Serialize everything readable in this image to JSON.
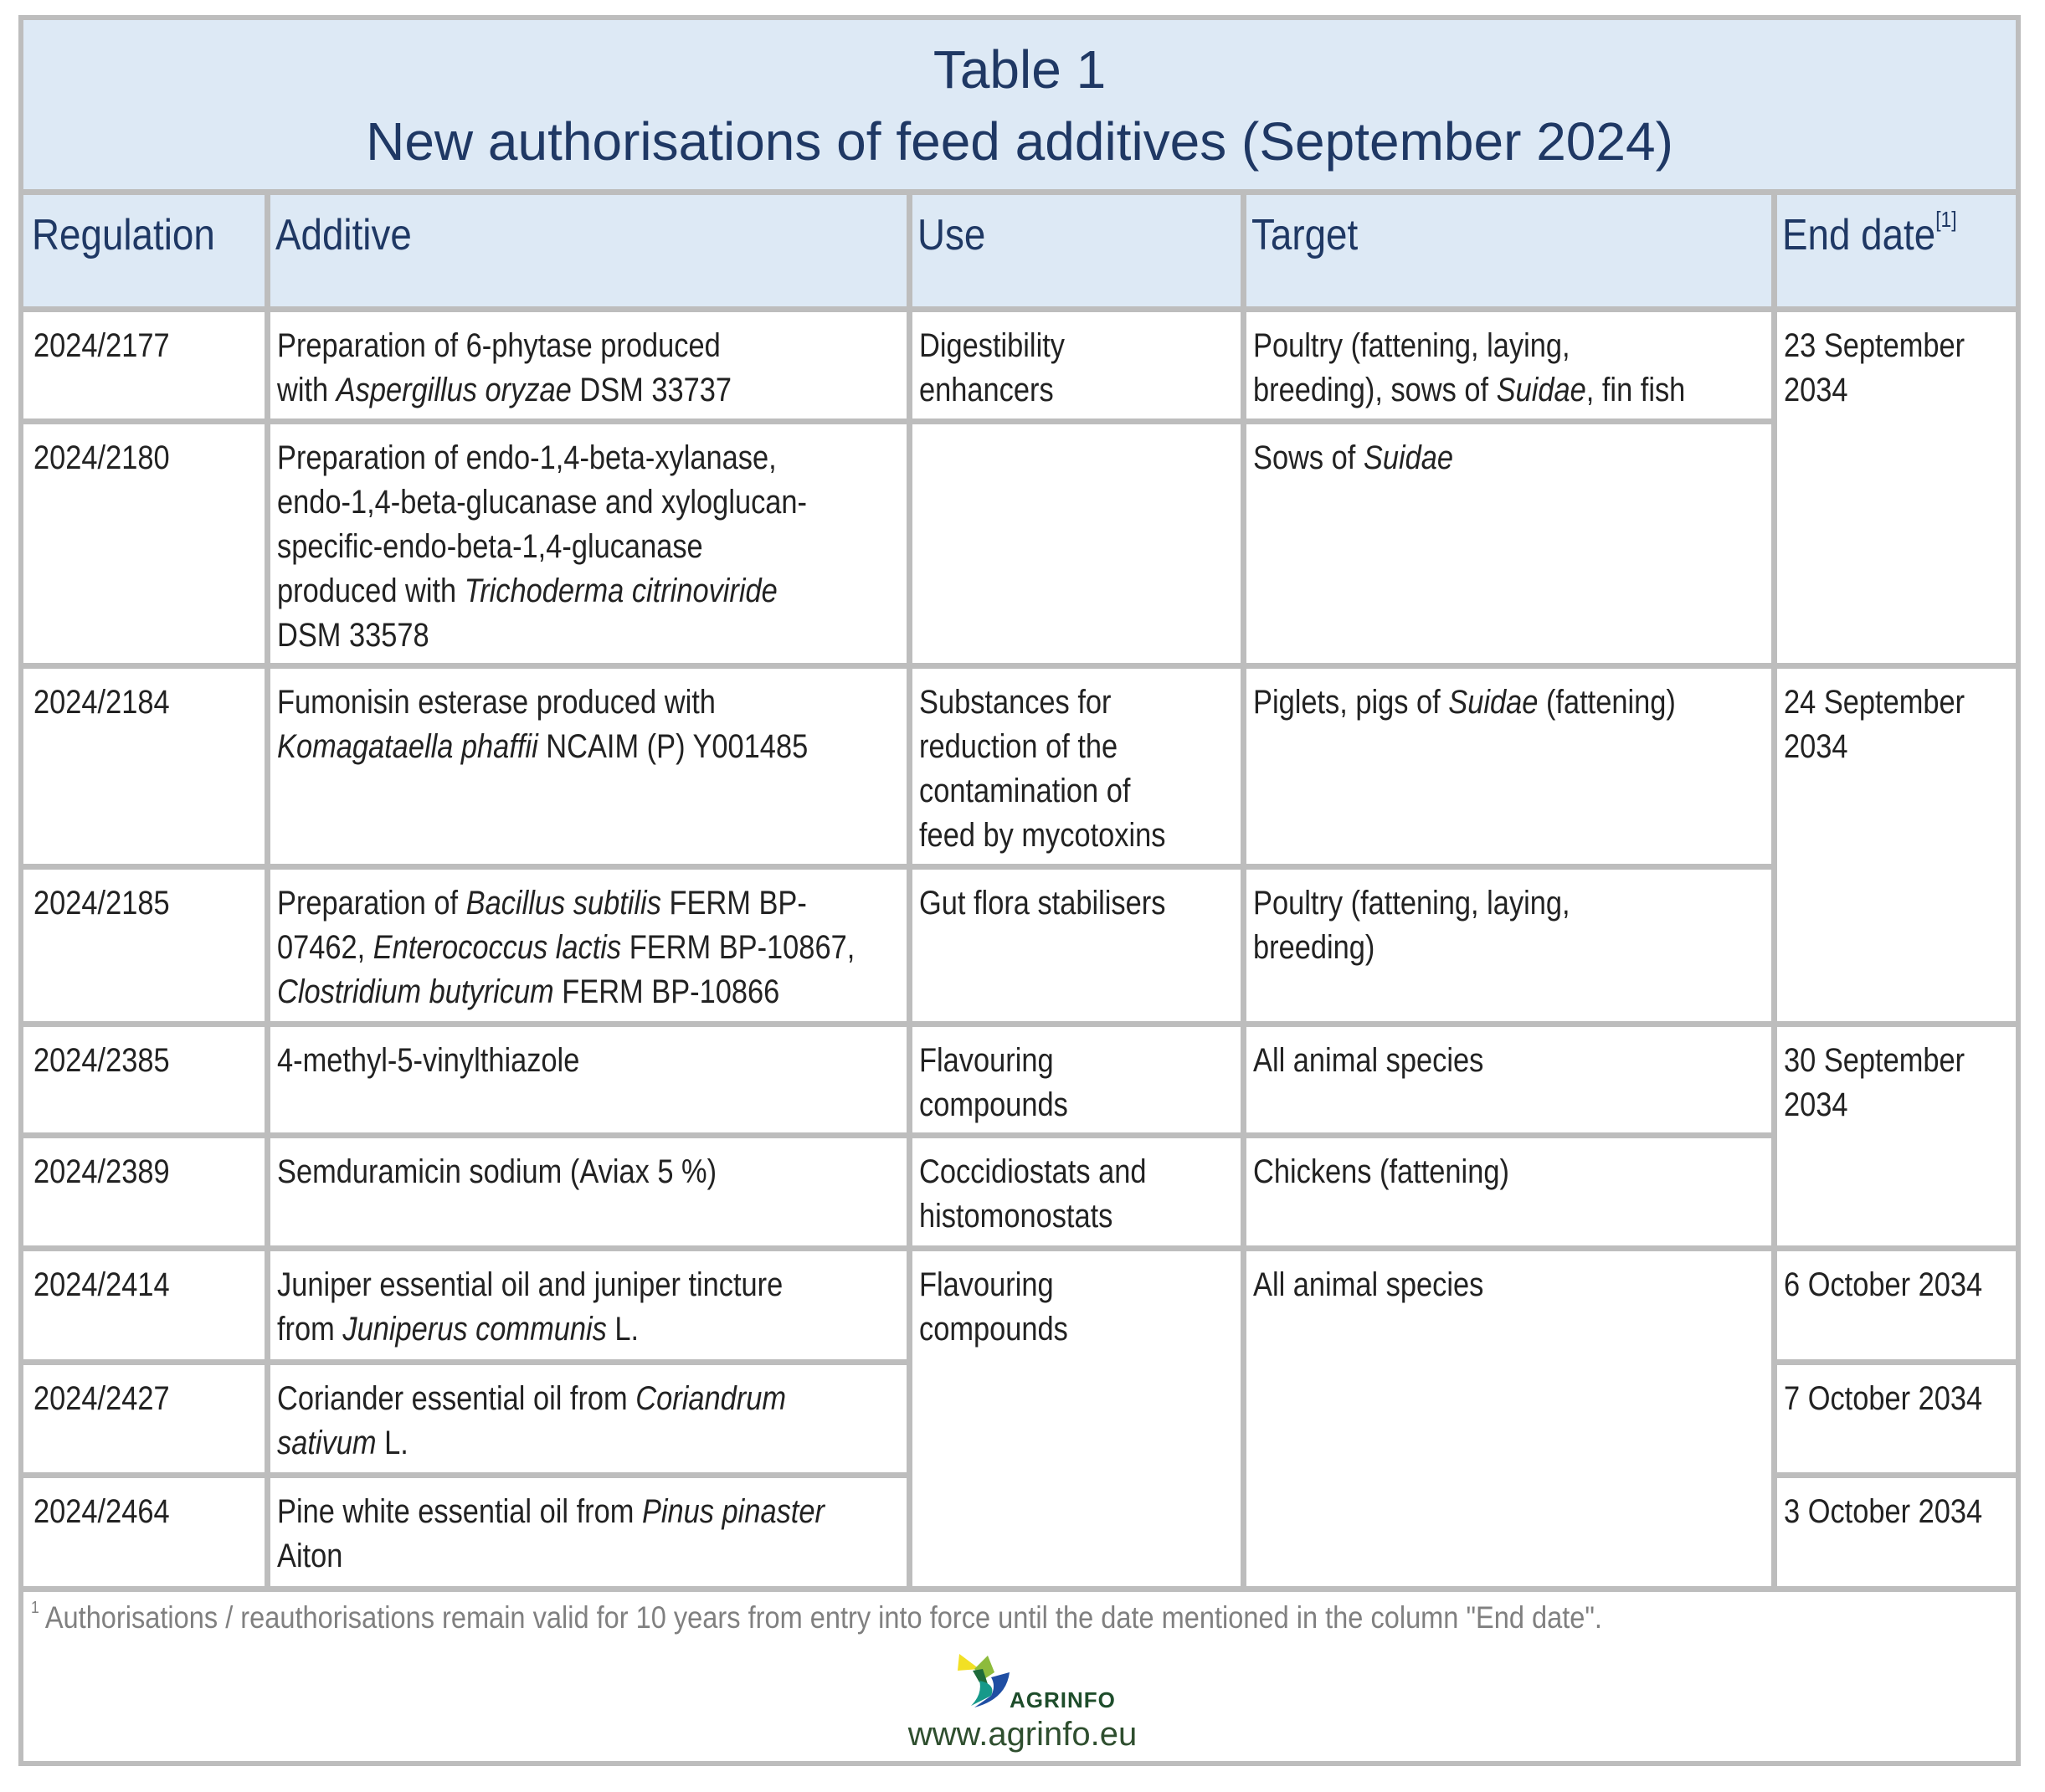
{
  "title": {
    "line1": "Table 1",
    "line2": "New authorisations of feed additives (September 2024)"
  },
  "colors": {
    "header_bg": "#dde9f5",
    "header_text": "#1f3864",
    "border": "#bdbdbd",
    "body_text": "#222222",
    "footnote_text": "#808080"
  },
  "columns": [
    {
      "label": "Regulation"
    },
    {
      "label": "Additive"
    },
    {
      "label": "Use"
    },
    {
      "label": "Target"
    },
    {
      "label": "End date",
      "footnote_ref": "[1]"
    }
  ],
  "rows": [
    {
      "regulation": "2024/2177",
      "additive": [
        [
          {
            "t": "Preparation of 6-phytase produced"
          }
        ],
        [
          {
            "t": "with "
          },
          {
            "t": "Aspergillus oryzae",
            "i": true
          },
          {
            "t": " DSM 33737"
          }
        ]
      ],
      "use": [
        [
          {
            "t": "Digestibility"
          }
        ],
        [
          {
            "t": "enhancers"
          }
        ]
      ],
      "target": [
        [
          {
            "t": "Poultry (fattening, laying,"
          }
        ],
        [
          {
            "t": "breeding), sows of "
          },
          {
            "t": "Suidae",
            "i": true
          },
          {
            "t": ", fin fish"
          }
        ]
      ]
    },
    {
      "regulation": "2024/2180",
      "additive": [
        [
          {
            "t": "Preparation of endo-1,4-beta-xylanase,"
          }
        ],
        [
          {
            "t": "endo-1,4-beta-glucanase and xyloglucan-"
          }
        ],
        [
          {
            "t": "specific-endo-beta-1,4-glucanase"
          }
        ],
        [
          {
            "t": "produced with "
          },
          {
            "t": "Trichoderma citrinoviride",
            "i": true
          }
        ],
        [
          {
            "t": "DSM 33578"
          }
        ]
      ],
      "use": [],
      "target": [
        [
          {
            "t": "Sows of "
          },
          {
            "t": "Suidae",
            "i": true
          }
        ]
      ]
    },
    {
      "regulation": "2024/2184",
      "additive": [
        [
          {
            "t": "Fumonisin esterase produced with"
          }
        ],
        [
          {
            "t": "Komagataella phaffii",
            "i": true
          },
          {
            "t": " NCAIM (P) Y001485"
          }
        ]
      ],
      "use": [
        [
          {
            "t": "Substances for"
          }
        ],
        [
          {
            "t": "reduction of the"
          }
        ],
        [
          {
            "t": "contamination of"
          }
        ],
        [
          {
            "t": "feed by mycotoxins"
          }
        ]
      ],
      "target": [
        [
          {
            "t": "Piglets, pigs of "
          },
          {
            "t": "Suidae",
            "i": true
          },
          {
            "t": " (fattening)"
          }
        ]
      ]
    },
    {
      "regulation": "2024/2185",
      "additive": [
        [
          {
            "t": "Preparation of "
          },
          {
            "t": "Bacillus subtilis",
            "i": true
          },
          {
            "t": " FERM BP-"
          }
        ],
        [
          {
            "t": "07462, "
          },
          {
            "t": "Enterococcus lactis",
            "i": true
          },
          {
            "t": " FERM BP-10867,"
          }
        ],
        [
          {
            "t": "Clostridium butyricum",
            "i": true
          },
          {
            "t": " FERM BP-10866"
          }
        ]
      ],
      "use": [
        [
          {
            "t": "Gut flora stabilisers"
          }
        ]
      ],
      "target": [
        [
          {
            "t": "Poultry (fattening, laying,"
          }
        ],
        [
          {
            "t": "breeding)"
          }
        ]
      ]
    },
    {
      "regulation": "2024/2385",
      "additive": [
        [
          {
            "t": "4-methyl-5-vinylthiazole"
          }
        ]
      ],
      "use": [
        [
          {
            "t": "Flavouring"
          }
        ],
        [
          {
            "t": "compounds"
          }
        ]
      ],
      "target": [
        [
          {
            "t": "All animal species"
          }
        ]
      ]
    },
    {
      "regulation": "2024/2389",
      "additive": [
        [
          {
            "t": "Semduramicin sodium (Aviax 5 %)"
          }
        ]
      ],
      "use": [
        [
          {
            "t": "Coccidiostats and"
          }
        ],
        [
          {
            "t": "histomonostats"
          }
        ]
      ],
      "target": [
        [
          {
            "t": "Chickens (fattening)"
          }
        ]
      ]
    },
    {
      "regulation": "2024/2414",
      "additive": [
        [
          {
            "t": "Juniper essential oil and juniper tincture"
          }
        ],
        [
          {
            "t": "from "
          },
          {
            "t": "Juniperus communis",
            "i": true
          },
          {
            "t": " L."
          }
        ]
      ],
      "use": [
        [
          {
            "t": "Flavouring"
          }
        ],
        [
          {
            "t": "compounds"
          }
        ]
      ],
      "target": [
        [
          {
            "t": "All animal species"
          }
        ]
      ],
      "end_date": [
        [
          {
            "t": "6 October 2034"
          }
        ]
      ]
    },
    {
      "regulation": "2024/2427",
      "additive": [
        [
          {
            "t": "Coriander essential oil from "
          },
          {
            "t": "Coriandrum",
            "i": true
          }
        ],
        [
          {
            "t": "sativum",
            "i": true
          },
          {
            "t": " L."
          }
        ]
      ],
      "end_date": [
        [
          {
            "t": "7 October 2034"
          }
        ]
      ]
    },
    {
      "regulation": "2024/2464",
      "additive": [
        [
          {
            "t": "Pine white essential oil from "
          },
          {
            "t": "Pinus pinaster",
            "i": true
          }
        ],
        [
          {
            "t": "Aiton"
          }
        ]
      ],
      "end_date": [
        [
          {
            "t": "3 October 2034"
          }
        ]
      ]
    }
  ],
  "merged_end_dates": [
    {
      "rows": [
        "2024/2177",
        "2024/2180"
      ],
      "lines": [
        [
          {
            "t": "23 September"
          }
        ],
        [
          {
            "t": "2034"
          }
        ]
      ]
    },
    {
      "rows": [
        "2024/2184",
        "2024/2185"
      ],
      "lines": [
        [
          {
            "t": "24 September"
          }
        ],
        [
          {
            "t": "2034"
          }
        ]
      ]
    },
    {
      "rows": [
        "2024/2385",
        "2024/2389"
      ],
      "lines": [
        [
          {
            "t": "30 September"
          }
        ],
        [
          {
            "t": "2034"
          }
        ]
      ]
    }
  ],
  "footnote": {
    "marker": "1",
    "text": "Authorisations / reauthorisations remain valid for 10 years from entry into force until the date mentioned in the column \"End date\"."
  },
  "branding": {
    "logo_name": "AGRINFO",
    "logo_icon": "agrinfo-logo-icon",
    "url": "www.agrinfo.eu",
    "logo_colors": [
      "#f2e024",
      "#8dbb3c",
      "#1e6b3a",
      "#16998a",
      "#1f4ea3"
    ]
  }
}
